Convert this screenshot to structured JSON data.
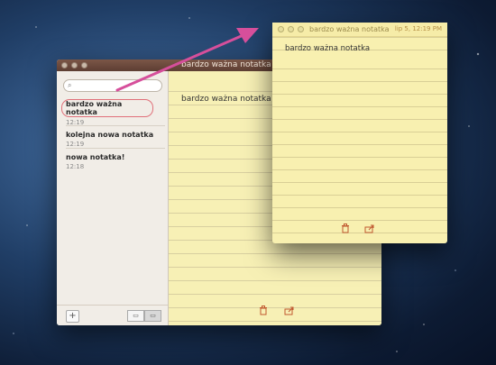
{
  "back_window": {
    "title": "bardzo ważna notatka",
    "search": {
      "placeholder": ""
    },
    "notes": [
      {
        "title": "bardzo ważna notatka",
        "time": "12:19",
        "selected": true
      },
      {
        "title": "kolejna nowa notatka",
        "time": "12:19",
        "selected": false
      },
      {
        "title": "nowa notatka!",
        "time": "12:18",
        "selected": false
      }
    ],
    "add_button": "+",
    "note_body": "bardzo ważna notatka"
  },
  "front_window": {
    "title": "bardzo ważna notatka",
    "date": "lip 5, 12:19 PM",
    "note_body": "bardzo ważna notatka"
  },
  "icons": {
    "trash": "trash-icon",
    "share": "share-icon",
    "search": "search-icon"
  },
  "colors": {
    "accent_arrow": "#d64f9b",
    "paper": "#f7f0b5",
    "titlebar": "#6a4a3d"
  }
}
